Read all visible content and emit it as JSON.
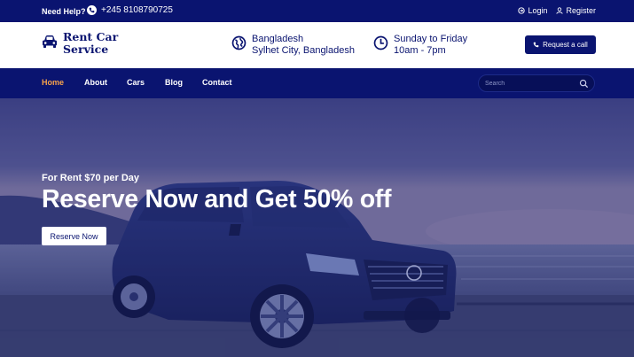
{
  "topbar": {
    "help_label": "Need Help?",
    "phone": "+245 8108790725",
    "login_label": "Login",
    "register_label": "Register"
  },
  "header": {
    "logo_text": "Rent Car Service",
    "location": {
      "line1": "Bangladesh",
      "line2": "Sylhet City, Bangladesh"
    },
    "hours": {
      "line1": "Sunday to Friday",
      "line2": "10am - 7pm"
    },
    "call_button_label": "Request a call"
  },
  "nav": {
    "items": [
      {
        "label": "Home",
        "active": true
      },
      {
        "label": "About"
      },
      {
        "label": "Cars"
      },
      {
        "label": "Blog"
      },
      {
        "label": "Contact"
      }
    ],
    "search_placeholder": "Search"
  },
  "hero": {
    "subtitle": "For Rent $70 per Day",
    "title": "Reserve Now and Get 50% off",
    "button_label": "Reserve Now"
  },
  "colors": {
    "primary": "#0a1470",
    "accent": "#f7a24b",
    "white": "#ffffff"
  },
  "icons": [
    "phone-icon",
    "login-icon",
    "user-icon",
    "car-icon",
    "globe-icon",
    "clock-icon",
    "search-icon"
  ]
}
